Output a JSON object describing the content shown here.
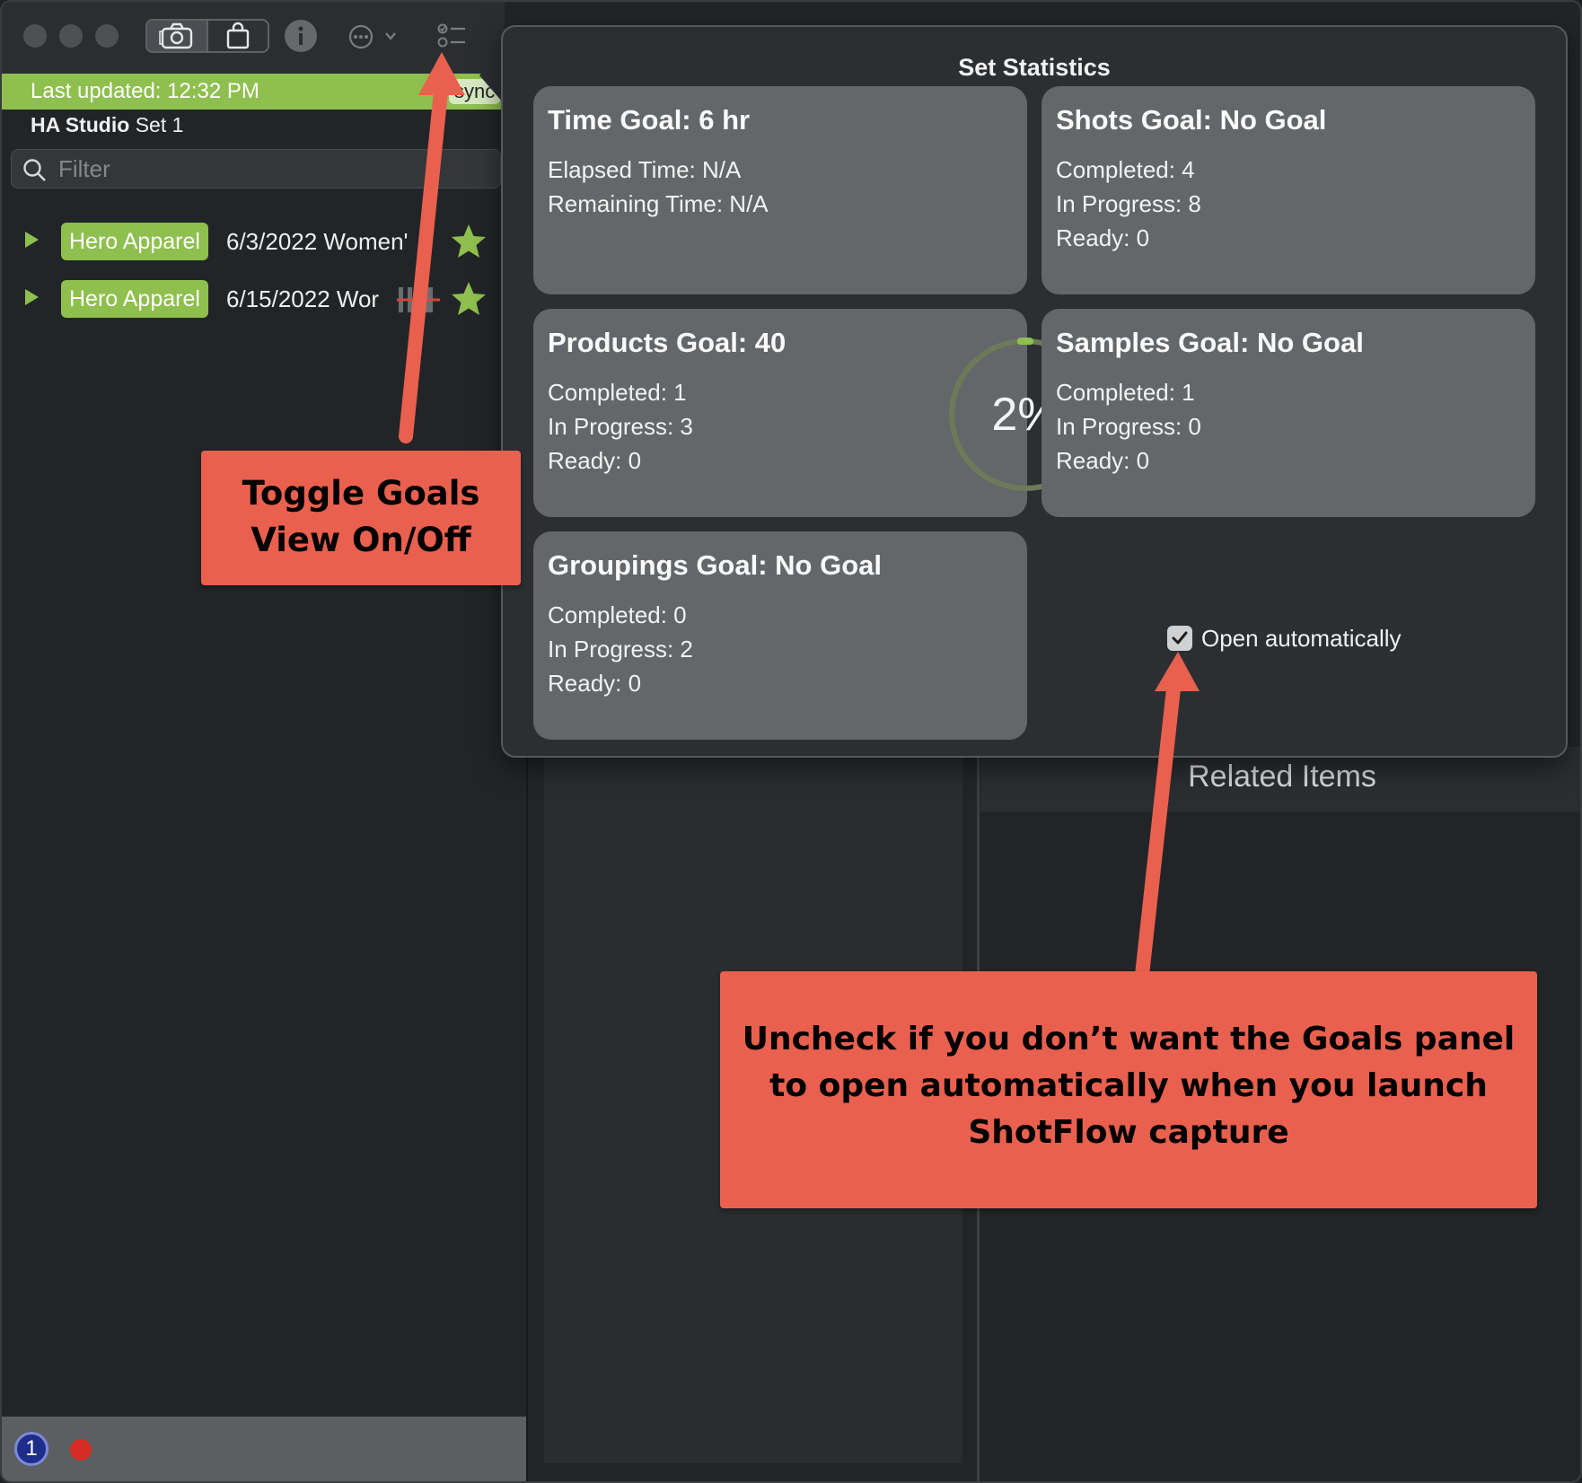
{
  "sidebar": {
    "status_text": "Last updated: 12:32 PM",
    "sync_label": "sync",
    "studio_name": "HA Studio",
    "set_name": "Set 1",
    "filter_placeholder": "Filter",
    "items": [
      {
        "client": "Hero Apparel",
        "date_text": "6/3/2022 Women'",
        "starred": true
      },
      {
        "client": "Hero Apparel",
        "date_text": "6/15/2022 Wor",
        "starred": true
      }
    ],
    "bottom_badge": "1"
  },
  "popover": {
    "title": "Set Statistics",
    "cards": [
      {
        "title": "Time Goal: 6 hr",
        "lines": [
          "Elapsed Time: N/A",
          "Remaining Time: N/A"
        ]
      },
      {
        "title": "Shots Goal: No Goal",
        "lines": [
          "Completed: 4",
          "In Progress: 8",
          "Ready: 0"
        ]
      },
      {
        "title": "Products Goal: 40",
        "lines": [
          "Completed: 1",
          "In Progress: 3",
          "Ready: 0"
        ],
        "progress_label": "2%",
        "progress_fraction": 0.02
      },
      {
        "title": "Samples Goal: No Goal",
        "lines": [
          "Completed: 1",
          "In Progress: 0",
          "Ready: 0"
        ]
      },
      {
        "title": "Groupings Goal: No Goal",
        "lines": [
          "Completed: 0",
          "In Progress: 2",
          "Ready: 0"
        ]
      }
    ],
    "open_automatically_label": "Open automatically",
    "open_automatically_checked": true
  },
  "main": {
    "related_items_title": "Related Items"
  },
  "annotations": {
    "toggle_goals": [
      "Toggle Goals",
      "View On/Off"
    ],
    "uncheck_note": [
      "Uncheck if you don’t want the Goals panel",
      "to open automatically when you launch",
      "ShotFlow capture"
    ]
  },
  "icons": {
    "toolbar": [
      "camera-icon",
      "shopping-bag-icon",
      "info-icon",
      "more-menu-icon",
      "goals-list-icon"
    ],
    "search": "search-icon",
    "disclosure": "disclosure-triangle-icon",
    "star": "star-icon"
  },
  "colors": {
    "accent_green": "#8fbf4e",
    "annotation_red": "#e9604f",
    "card_gray": "#646769",
    "ring_track": "#6d7a5a"
  }
}
